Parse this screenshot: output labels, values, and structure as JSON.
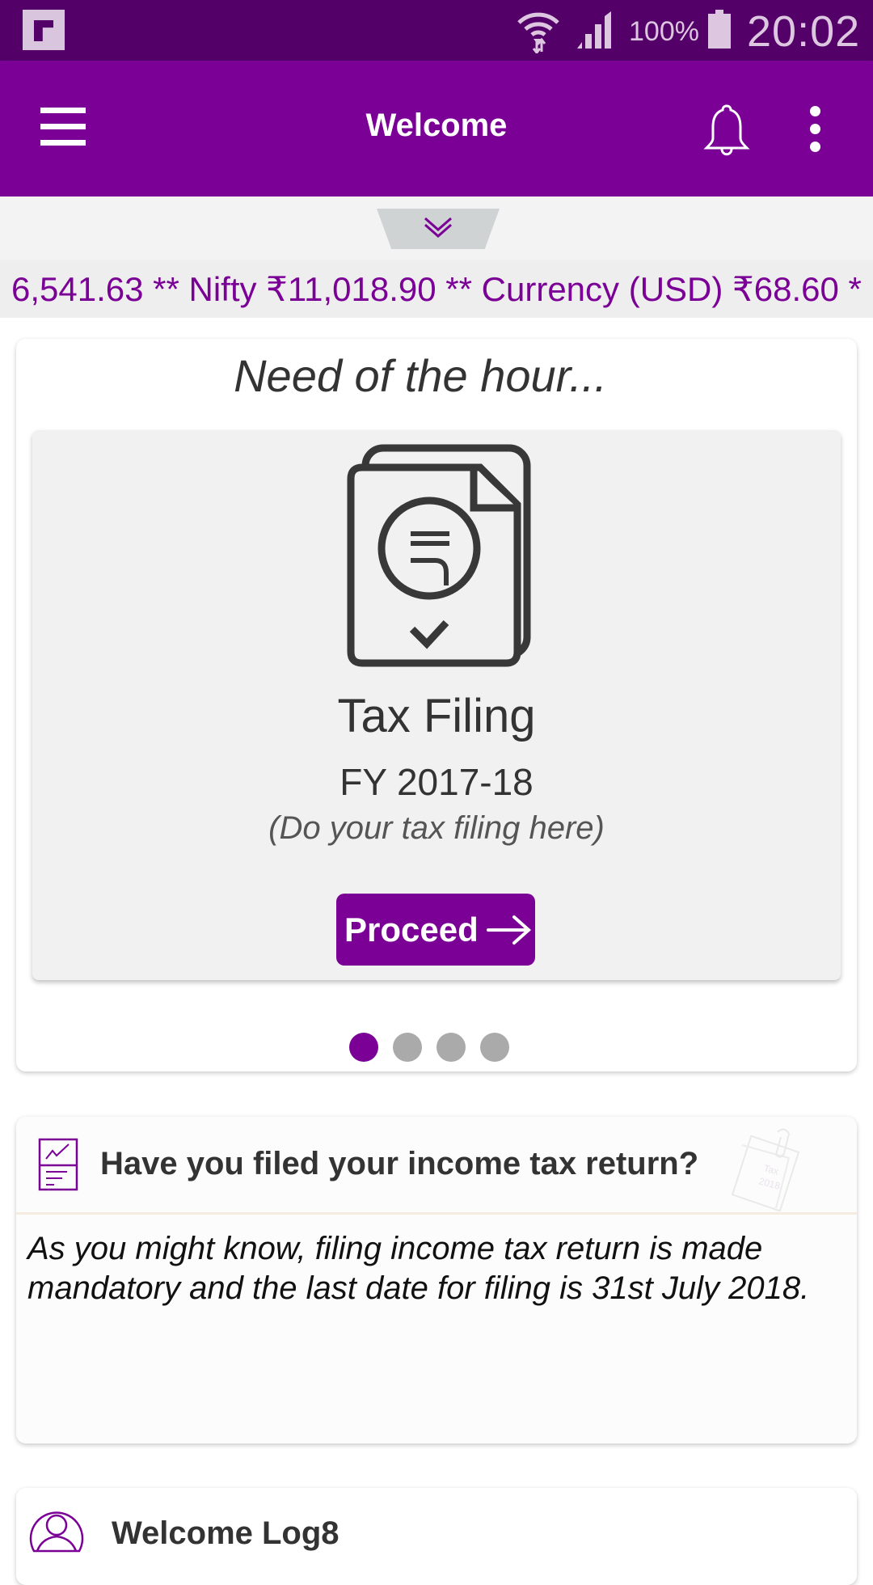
{
  "status_bar": {
    "battery_percent": "100%",
    "time": "20:02",
    "icons": [
      "app-notification-icon",
      "wifi-data-icon",
      "cell-signal-icon",
      "battery-icon"
    ]
  },
  "app_bar": {
    "title": "Welcome",
    "menu_icon": "hamburger-menu-icon",
    "notifications_icon": "bell-icon",
    "overflow_icon": "more-vert-icon",
    "background_color": "#7a0096"
  },
  "pull_down": {
    "icon": "double-chevron-down-icon"
  },
  "ticker": {
    "text": "6,541.63 ** Nifty  ₹11,018.90 ** Currency (USD)  ₹68.60 *",
    "color": "#7a0096"
  },
  "need_of_hour": {
    "title": "Need of the hour...",
    "slides": [
      {
        "icon": "tax-document-rupee-icon",
        "title": "Tax Filing",
        "subtitle": "FY 2017-18",
        "hint": "(Do your tax filing here)",
        "button_label": "Proceed",
        "button_icon": "arrow-right-icon"
      }
    ],
    "pagination": {
      "total": 4,
      "active_index": 0
    }
  },
  "tax_notice": {
    "icon": "report-chart-icon",
    "title": "Have you filed your income tax return?",
    "watermark_icon": "tax-2018-note-icon",
    "body": "As you might know, filing income tax return is made mandatory and the last date for filing is 31st July 2018."
  },
  "welcome_card": {
    "icon": "user-avatar-icon",
    "text": "Welcome Log8"
  }
}
